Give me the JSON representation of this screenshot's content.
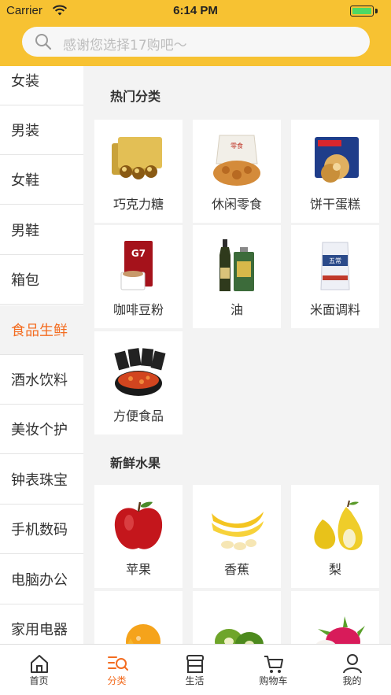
{
  "status_bar": {
    "carrier": "Carrier",
    "time": "6:14 PM"
  },
  "search": {
    "placeholder": "感谢您选择17购吧～"
  },
  "sidebar": {
    "items": [
      {
        "label": "女装"
      },
      {
        "label": "男装"
      },
      {
        "label": "女鞋"
      },
      {
        "label": "男鞋"
      },
      {
        "label": "箱包"
      },
      {
        "label": "食品生鲜"
      },
      {
        "label": "酒水饮料"
      },
      {
        "label": "美妆个护"
      },
      {
        "label": "钟表珠宝"
      },
      {
        "label": "手机数码"
      },
      {
        "label": "电脑办公"
      },
      {
        "label": "家用电器"
      }
    ],
    "active_index": 5
  },
  "sections": [
    {
      "title": "热门分类",
      "items": [
        {
          "label": "巧克力糖",
          "icon": "chocolate-box-icon"
        },
        {
          "label": "休闲零食",
          "icon": "snack-bag-icon"
        },
        {
          "label": "饼干蛋糕",
          "icon": "cookie-tin-icon"
        },
        {
          "label": "咖啡豆粉",
          "icon": "coffee-pack-icon"
        },
        {
          "label": "油",
          "icon": "oil-bottle-icon"
        },
        {
          "label": "米面调料",
          "icon": "rice-bag-icon"
        },
        {
          "label": "方便食品",
          "icon": "instant-food-icon"
        }
      ]
    },
    {
      "title": "新鲜水果",
      "items": [
        {
          "label": "苹果",
          "icon": "apple-icon"
        },
        {
          "label": "香蕉",
          "icon": "banana-icon"
        },
        {
          "label": "梨",
          "icon": "pear-icon"
        },
        {
          "label": "",
          "icon": "orange-icon"
        },
        {
          "label": "",
          "icon": "kiwi-icon"
        },
        {
          "label": "",
          "icon": "dragon-fruit-icon"
        }
      ]
    }
  ],
  "tabbar": {
    "items": [
      {
        "label": "首页",
        "icon": "home-icon"
      },
      {
        "label": "分类",
        "icon": "category-search-icon"
      },
      {
        "label": "生活",
        "icon": "store-icon"
      },
      {
        "label": "购物车",
        "icon": "cart-icon"
      },
      {
        "label": "我的",
        "icon": "user-icon"
      }
    ],
    "active_index": 1
  },
  "colors": {
    "header": "#f7c232",
    "accent": "#f36c20"
  }
}
